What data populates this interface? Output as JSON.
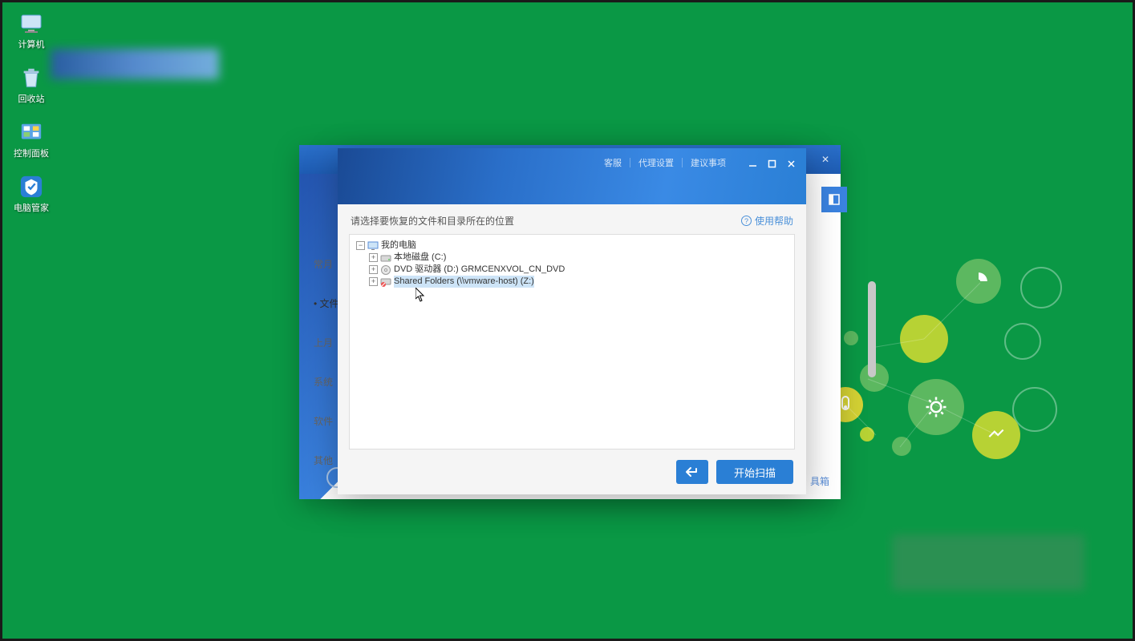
{
  "desktop": {
    "icons": [
      {
        "label": "计算机"
      },
      {
        "label": "回收站"
      },
      {
        "label": "控制面板"
      },
      {
        "label": "电脑管家"
      }
    ]
  },
  "back_window": {
    "sidebar": [
      "常月",
      "• 文件",
      "上月",
      "系统",
      "软件",
      "其他"
    ],
    "footer_text": "具箱"
  },
  "dialog": {
    "links": [
      "客服",
      "代理设置",
      "建议事项"
    ],
    "prompt": "请选择要恢复的文件和目录所在的位置",
    "help_label": "使用帮助",
    "tree": {
      "root": "我的电脑",
      "children": [
        "本地磁盘 (C:)",
        "DVD 驱动器 (D:) GRMCENXVOL_CN_DVD",
        "Shared Folders (\\\\vmware-host) (Z:)"
      ]
    },
    "scan_button": "开始扫描"
  }
}
